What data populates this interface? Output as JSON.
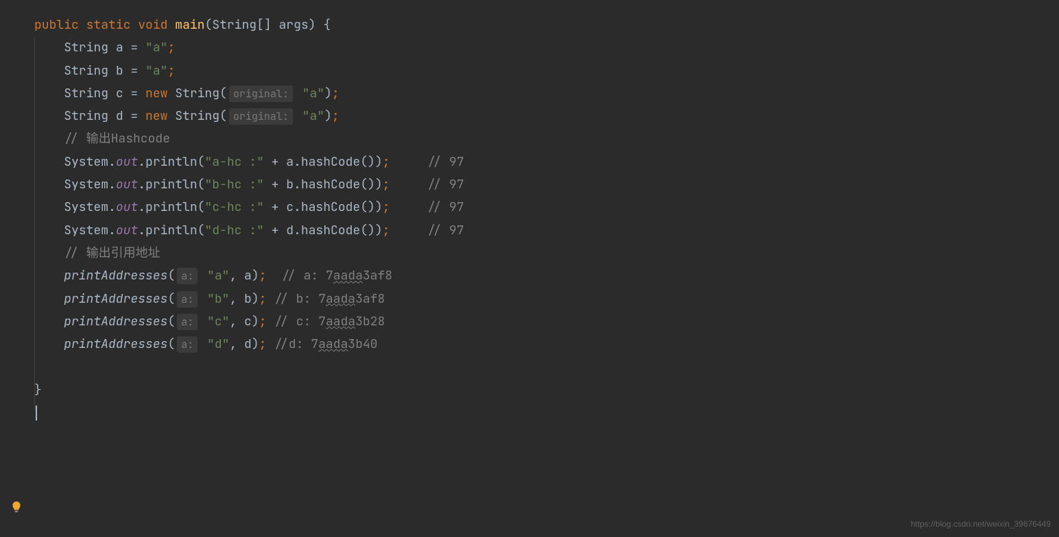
{
  "code": {
    "line1": {
      "kw_public": "public",
      "kw_static": "static",
      "kw_void": "void",
      "method": "main",
      "params": "(String[] args) {"
    },
    "line2": {
      "type": "String",
      "var": " a ",
      "eq": "= ",
      "str": "\"a\"",
      "semi": ";"
    },
    "line3": {
      "type": "String",
      "var": " b ",
      "eq": "= ",
      "str": "\"a\"",
      "semi": ";"
    },
    "line4": {
      "type": "String",
      "var": " c ",
      "eq": "= ",
      "kw_new": "new",
      "ctor": " String(",
      "hint": "original:",
      "str": "\"a\"",
      "close": ")",
      "semi": ";"
    },
    "line5": {
      "type": "String",
      "var": " d ",
      "eq": "= ",
      "kw_new": "new",
      "ctor": " String(",
      "hint": "original:",
      "str": "\"a\"",
      "close": ")",
      "semi": ";"
    },
    "line6": {
      "comment": "// 输出Hashcode"
    },
    "line7": {
      "sys": "System.",
      "out": "out",
      "call": ".println(",
      "str": "\"a-hc :\"",
      "plus": " + a.hashCode())",
      "semi": ";",
      "comment": "     // 97"
    },
    "line8": {
      "sys": "System.",
      "out": "out",
      "call": ".println(",
      "str": "\"b-hc :\"",
      "plus": " + b.hashCode())",
      "semi": ";",
      "comment": "     // 97"
    },
    "line9": {
      "sys": "System.",
      "out": "out",
      "call": ".println(",
      "str": "\"c-hc :\"",
      "plus": " + c.hashCode())",
      "semi": ";",
      "comment": "     // 97"
    },
    "line10": {
      "sys": "System.",
      "out": "out",
      "call": ".println(",
      "str": "\"d-hc :\"",
      "plus": " + d.hashCode())",
      "semi": ";",
      "comment": "     // 97"
    },
    "line11": {
      "comment": "// 输出引用地址"
    },
    "line12": {
      "call": "printAddresses",
      "open": "(",
      "hint": "a:",
      "str": "\"a\"",
      "args": ", a)",
      "semi": ";",
      "com_pre": "  // a: 7",
      "com_u": "aada",
      "com_post": "3af8"
    },
    "line13": {
      "call": "printAddresses",
      "open": "(",
      "hint": "a:",
      "str": "\"b\"",
      "args": ", b)",
      "semi": ";",
      "com_pre": " // b: 7",
      "com_u": "aada",
      "com_post": "3af8"
    },
    "line14": {
      "call": "printAddresses",
      "open": "(",
      "hint": "a:",
      "str": "\"c\"",
      "args": ", c)",
      "semi": ";",
      "com_pre": " // c: 7",
      "com_u": "aada",
      "com_post": "3b28"
    },
    "line15": {
      "call": "printAddresses",
      "open": "(",
      "hint": "a:",
      "str": "\"d\"",
      "args": ", d)",
      "semi": ";",
      "com_pre": " //d: 7",
      "com_u": "aada",
      "com_post": "3b40"
    },
    "line16": {
      "brace": "}"
    }
  },
  "watermark": "https://blog.csdn.net/weixin_39676449"
}
